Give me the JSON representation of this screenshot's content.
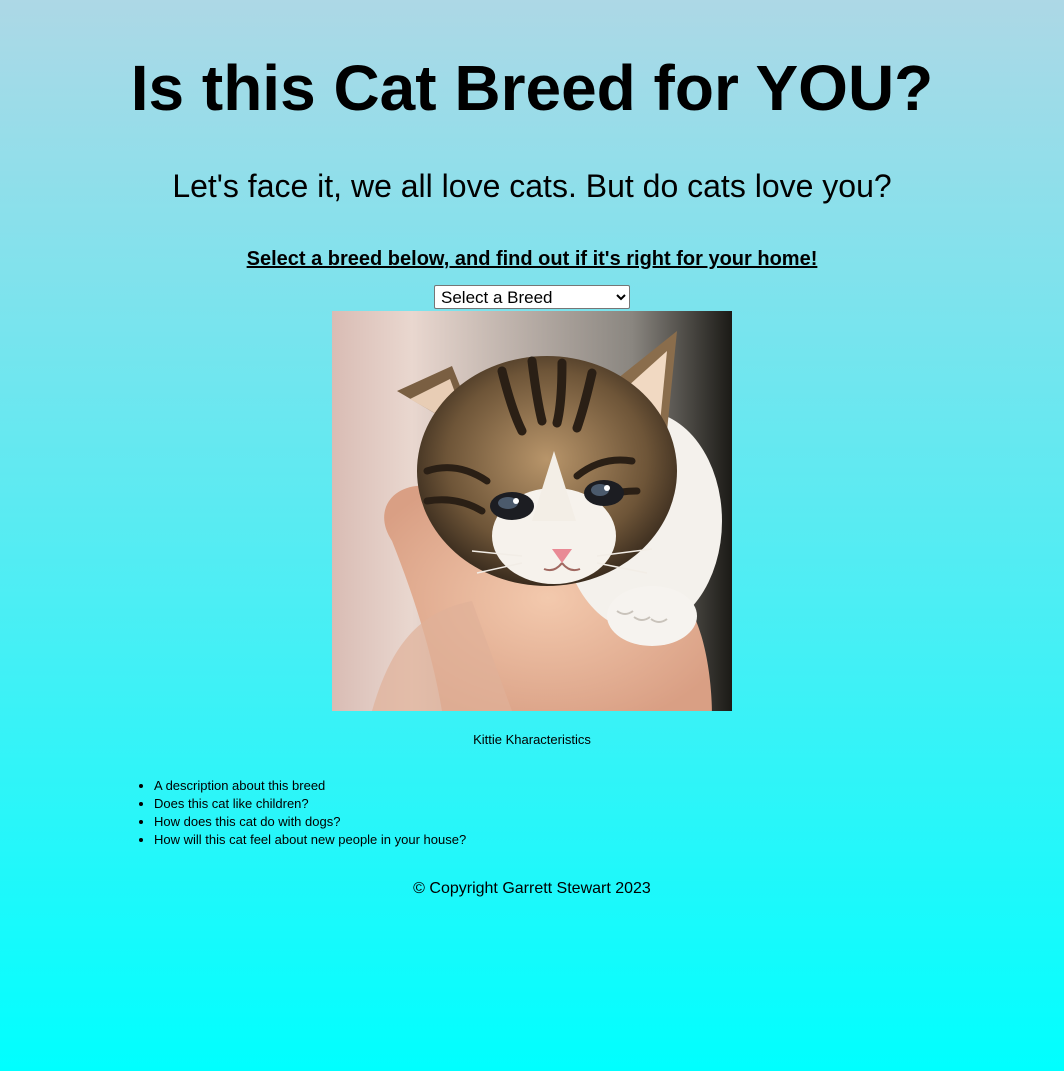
{
  "header": {
    "title": "Is this Cat Breed for YOU?",
    "subtitle": "Let's face it, we all love cats. But do cats love you?",
    "prompt": "Select a breed below, and find out if it's right for your home!"
  },
  "breed_select": {
    "selected": "Select a Breed",
    "options": [
      "Select a Breed"
    ]
  },
  "photo": {
    "subject": "kitten held in a hand"
  },
  "caption": "Kittie Kharacteristics",
  "traits": [
    "A description about this breed",
    "Does this cat like children?",
    "How does this cat do with dogs?",
    "How will this cat feel about new people in your house?"
  ],
  "footer": {
    "copyright": "© Copyright Garrett Stewart 2023"
  },
  "colors": {
    "gradient_top": "#add8e6",
    "gradient_bottom": "#00ffff"
  }
}
